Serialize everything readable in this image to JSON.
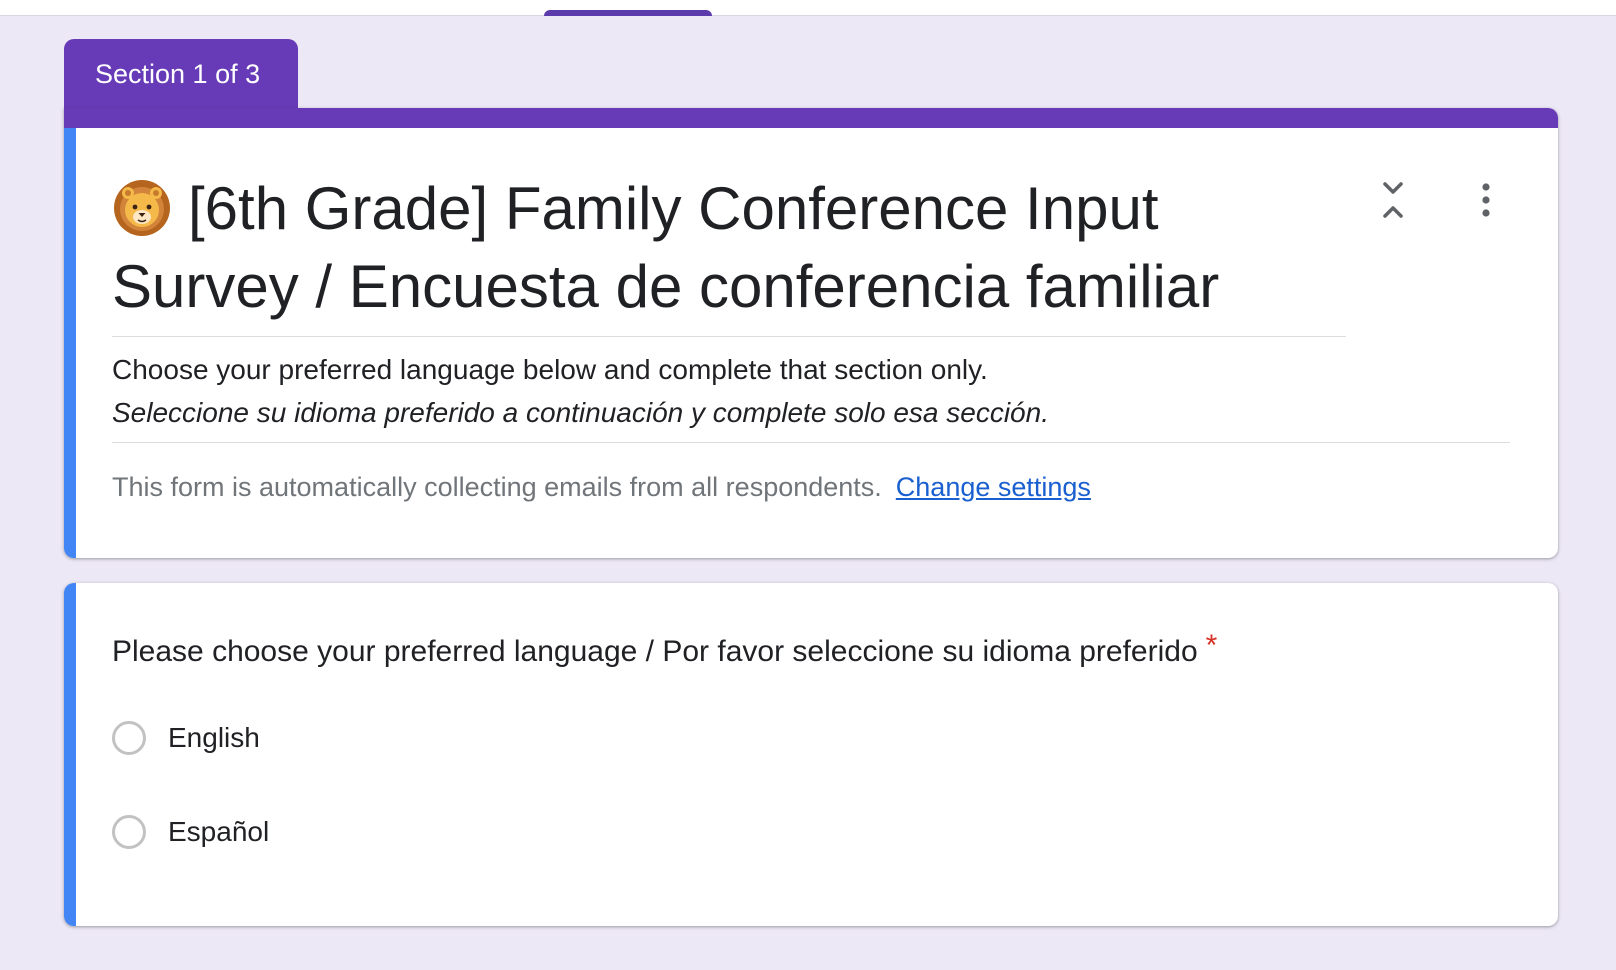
{
  "colors": {
    "theme": "#673ab7",
    "accent": "#4285f4",
    "background": "#ede8f6",
    "link": "#1a5fd0",
    "required": "#d93025"
  },
  "section": {
    "label": "Section 1 of 3"
  },
  "form": {
    "title_text": "[6th Grade] Family Conference Input Survey / Encuesta de conferencia familiar",
    "title_icon": "lion-face-icon",
    "description_line1": "Choose your preferred language below and complete that section only.",
    "description_line2": "Seleccione su idioma preferido a continuación y complete solo esa sección.",
    "email_notice": "This form is automatically collecting emails from all respondents.",
    "change_settings_label": "Change settings"
  },
  "question": {
    "title": "Please choose your preferred language / Por favor seleccione su idioma preferido",
    "required_marker": "*",
    "options": [
      {
        "label": "English",
        "selected": false
      },
      {
        "label": "Español",
        "selected": false
      }
    ]
  }
}
